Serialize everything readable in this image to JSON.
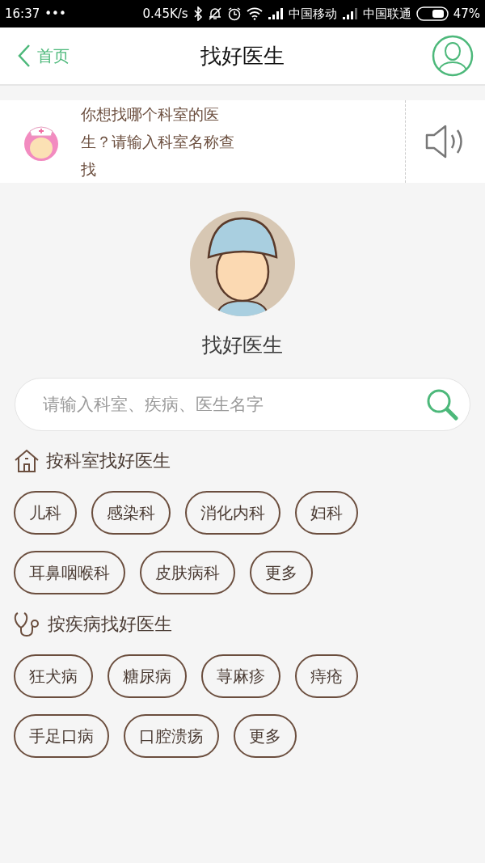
{
  "status_bar": {
    "time": "16:37",
    "dots": "•••",
    "speed": "0.45K/s",
    "carrier_1": "中国移动",
    "carrier_2": "中国联通",
    "battery": "47%"
  },
  "header": {
    "back": "首页",
    "title": "找好医生"
  },
  "hint": {
    "text": "你想找哪个科室的医生？请输入科室名称查找"
  },
  "hero": {
    "title": "找好医生"
  },
  "search": {
    "placeholder": "请输入科室、疾病、医生名字"
  },
  "sections": [
    {
      "kind": "department",
      "title": "按科室找好医生",
      "tags": [
        "儿科",
        "感染科",
        "消化内科",
        "妇科",
        "耳鼻咽喉科",
        "皮肤病科",
        "更多"
      ]
    },
    {
      "kind": "disease",
      "title": "按疾病找好医生",
      "tags": [
        "狂犬病",
        "糖尿病",
        "荨麻疹",
        "痔疮",
        "手足口病",
        "口腔溃疡",
        "更多"
      ]
    }
  ]
}
